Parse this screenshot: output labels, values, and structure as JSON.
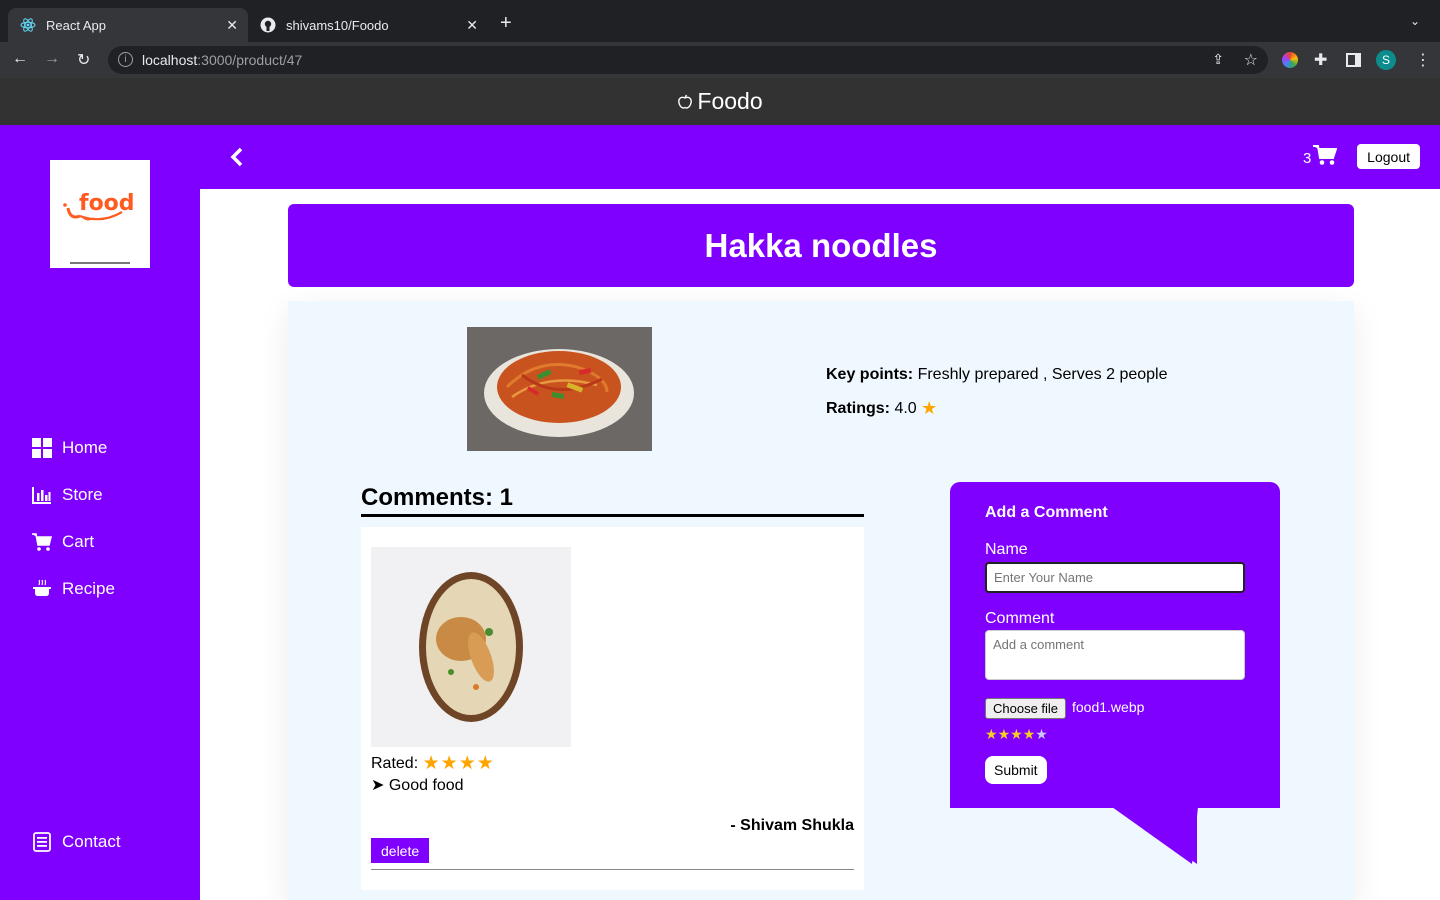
{
  "browser": {
    "tabs": [
      {
        "label": "React App",
        "active": true
      },
      {
        "label": "shivams10/Foodo",
        "active": false
      }
    ],
    "url_host": "localhost",
    "url_path": ":3000/product/47",
    "profile_initial": "S"
  },
  "app": {
    "title": "Foodo"
  },
  "sidebar": {
    "logo_text": "food",
    "items": [
      {
        "label": "Home",
        "icon": "grid-icon"
      },
      {
        "label": "Store",
        "icon": "bar-chart-icon"
      },
      {
        "label": "Cart",
        "icon": "cart-icon"
      },
      {
        "label": "Recipe",
        "icon": "cooking-pot-icon"
      },
      {
        "label": "Contact",
        "icon": "contact-icon"
      }
    ]
  },
  "topbar": {
    "cart_count": "3",
    "logout_label": "Logout"
  },
  "product": {
    "name": "Hakka noodles",
    "key_points_label": "Key points:",
    "key_points": "Freshly prepared , Serves 2 people",
    "ratings_label": "Ratings:",
    "rating": "4.0"
  },
  "comments": {
    "heading": "Comments: 1",
    "items": [
      {
        "rated_label": "Rated:",
        "stars": 4,
        "text": "➤ Good food",
        "author": "- Shivam Shukla",
        "delete_label": "delete"
      }
    ]
  },
  "add_comment": {
    "title": "Add a Comment",
    "name_label": "Name",
    "name_placeholder": "Enter Your Name",
    "comment_label": "Comment",
    "comment_placeholder": "Add a comment",
    "file_button": "Choose file",
    "file_name": "food1.webp",
    "rating_stars": 4,
    "submit_label": "Submit"
  },
  "colors": {
    "brand_purple": "#8000ff",
    "star": "#ffa500",
    "panel": "#f0f8ff"
  }
}
